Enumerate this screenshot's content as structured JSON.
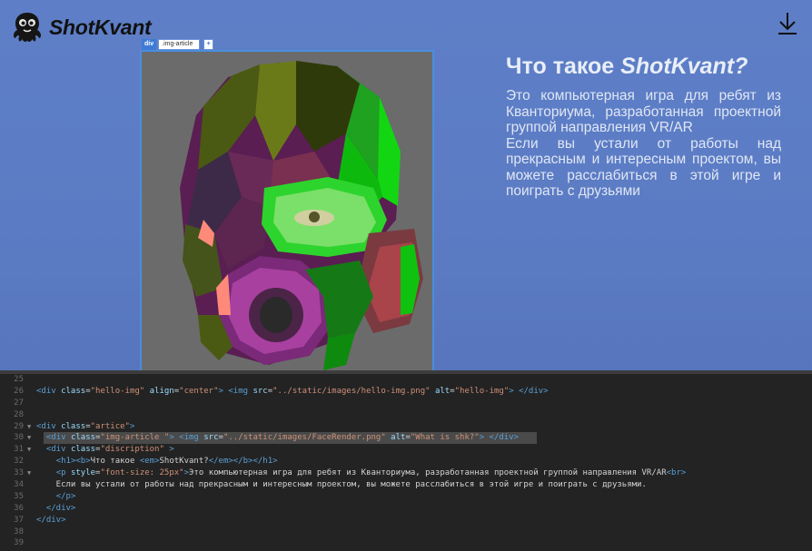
{
  "logo": {
    "text": "ShotKvant"
  },
  "inspector": {
    "tag": "div",
    "class_name": ".img-article",
    "add_label": "+"
  },
  "article": {
    "heading_prefix": "Что такое ",
    "heading_emphasis": "ShotKvant?",
    "description_line1": "Это компьютерная игра для ребят из Кванториума, разработанная проектной группой направления VR/AR",
    "description_line2": "Если вы устали от работы над прекрасным и интересным проектом, вы можете расслабиться в этой игре и поиграть с друзьями",
    "image_alt": "What is shk?"
  },
  "colors": {
    "background": "#5b7cc4",
    "selection_outline": "#4a8ee0",
    "editor_bg": "#232323"
  },
  "icons": {
    "logo": "octopus-logo-icon",
    "download": "download-icon"
  },
  "code": {
    "lines": [
      {
        "n": "25",
        "fold": false,
        "hl": false,
        "parts": []
      },
      {
        "n": "26",
        "fold": false,
        "hl": false,
        "parts": [
          {
            "c": "t",
            "t": "<div "
          },
          {
            "c": "a",
            "t": "class"
          },
          {
            "c": "x",
            "t": "="
          },
          {
            "c": "s",
            "t": "\"hello-img\""
          },
          {
            "c": "a",
            "t": " align"
          },
          {
            "c": "x",
            "t": "="
          },
          {
            "c": "s",
            "t": "\"center\""
          },
          {
            "c": "t",
            "t": "> <img "
          },
          {
            "c": "a",
            "t": "src"
          },
          {
            "c": "x",
            "t": "="
          },
          {
            "c": "s",
            "t": "\"../static/images/hello-img.png\""
          },
          {
            "c": "a",
            "t": " alt"
          },
          {
            "c": "x",
            "t": "="
          },
          {
            "c": "s",
            "t": "\"hello-img\""
          },
          {
            "c": "t",
            "t": "> </div>"
          }
        ]
      },
      {
        "n": "27",
        "fold": false,
        "hl": false,
        "parts": []
      },
      {
        "n": "28",
        "fold": false,
        "hl": false,
        "parts": []
      },
      {
        "n": "29",
        "fold": true,
        "hl": false,
        "parts": [
          {
            "c": "t",
            "t": "<div "
          },
          {
            "c": "a",
            "t": "class"
          },
          {
            "c": "x",
            "t": "="
          },
          {
            "c": "s",
            "t": "\"artice\""
          },
          {
            "c": "t",
            "t": ">"
          }
        ]
      },
      {
        "n": "30",
        "fold": true,
        "hl": true,
        "parts": [
          {
            "c": "x",
            "t": "  "
          },
          {
            "c": "t",
            "t": "<div "
          },
          {
            "c": "a",
            "t": "class"
          },
          {
            "c": "x",
            "t": "="
          },
          {
            "c": "s",
            "t": "\"img-article \""
          },
          {
            "c": "t",
            "t": "> <img "
          },
          {
            "c": "a",
            "t": "src"
          },
          {
            "c": "x",
            "t": "="
          },
          {
            "c": "s",
            "t": "\"../static/images/FaceRender.png\""
          },
          {
            "c": "a",
            "t": " alt"
          },
          {
            "c": "x",
            "t": "="
          },
          {
            "c": "s",
            "t": "\"What is shk?\""
          },
          {
            "c": "t",
            "t": "> </div>"
          }
        ]
      },
      {
        "n": "31",
        "fold": true,
        "hl": false,
        "parts": [
          {
            "c": "x",
            "t": "  "
          },
          {
            "c": "t",
            "t": "<div "
          },
          {
            "c": "a",
            "t": "class"
          },
          {
            "c": "x",
            "t": "="
          },
          {
            "c": "s",
            "t": "\"discription\""
          },
          {
            "c": "t",
            "t": " >"
          }
        ]
      },
      {
        "n": "32",
        "fold": false,
        "hl": false,
        "parts": [
          {
            "c": "x",
            "t": "    "
          },
          {
            "c": "t",
            "t": "<h1><b>"
          },
          {
            "c": "x",
            "t": "Что такое "
          },
          {
            "c": "t",
            "t": "<em>"
          },
          {
            "c": "x",
            "t": "ShotKvant?"
          },
          {
            "c": "t",
            "t": "</em></b></h1>"
          }
        ]
      },
      {
        "n": "33",
        "fold": true,
        "hl": false,
        "parts": [
          {
            "c": "x",
            "t": "    "
          },
          {
            "c": "t",
            "t": "<p "
          },
          {
            "c": "a",
            "t": "style"
          },
          {
            "c": "x",
            "t": "="
          },
          {
            "c": "s",
            "t": "\"font-size: 25px\""
          },
          {
            "c": "t",
            "t": ">"
          },
          {
            "c": "x",
            "t": "Это компьютерная игра для ребят из Кванториума, разработанная проектной группой направления VR/AR"
          },
          {
            "c": "t",
            "t": "<br>"
          }
        ]
      },
      {
        "n": "34",
        "fold": false,
        "hl": false,
        "parts": [
          {
            "c": "x",
            "t": "    Если вы устали от работы над прекрасным и интересным проектом, вы можете расслабиться в этой игре и поиграть с друзьями."
          }
        ]
      },
      {
        "n": "35",
        "fold": false,
        "hl": false,
        "parts": [
          {
            "c": "x",
            "t": "    "
          },
          {
            "c": "t",
            "t": "</p>"
          }
        ]
      },
      {
        "n": "36",
        "fold": false,
        "hl": false,
        "parts": [
          {
            "c": "x",
            "t": "  "
          },
          {
            "c": "t",
            "t": "</div>"
          }
        ]
      },
      {
        "n": "37",
        "fold": false,
        "hl": false,
        "parts": [
          {
            "c": "t",
            "t": "</div>"
          }
        ]
      },
      {
        "n": "38",
        "fold": false,
        "hl": false,
        "parts": []
      },
      {
        "n": "39",
        "fold": false,
        "hl": false,
        "parts": []
      }
    ]
  }
}
